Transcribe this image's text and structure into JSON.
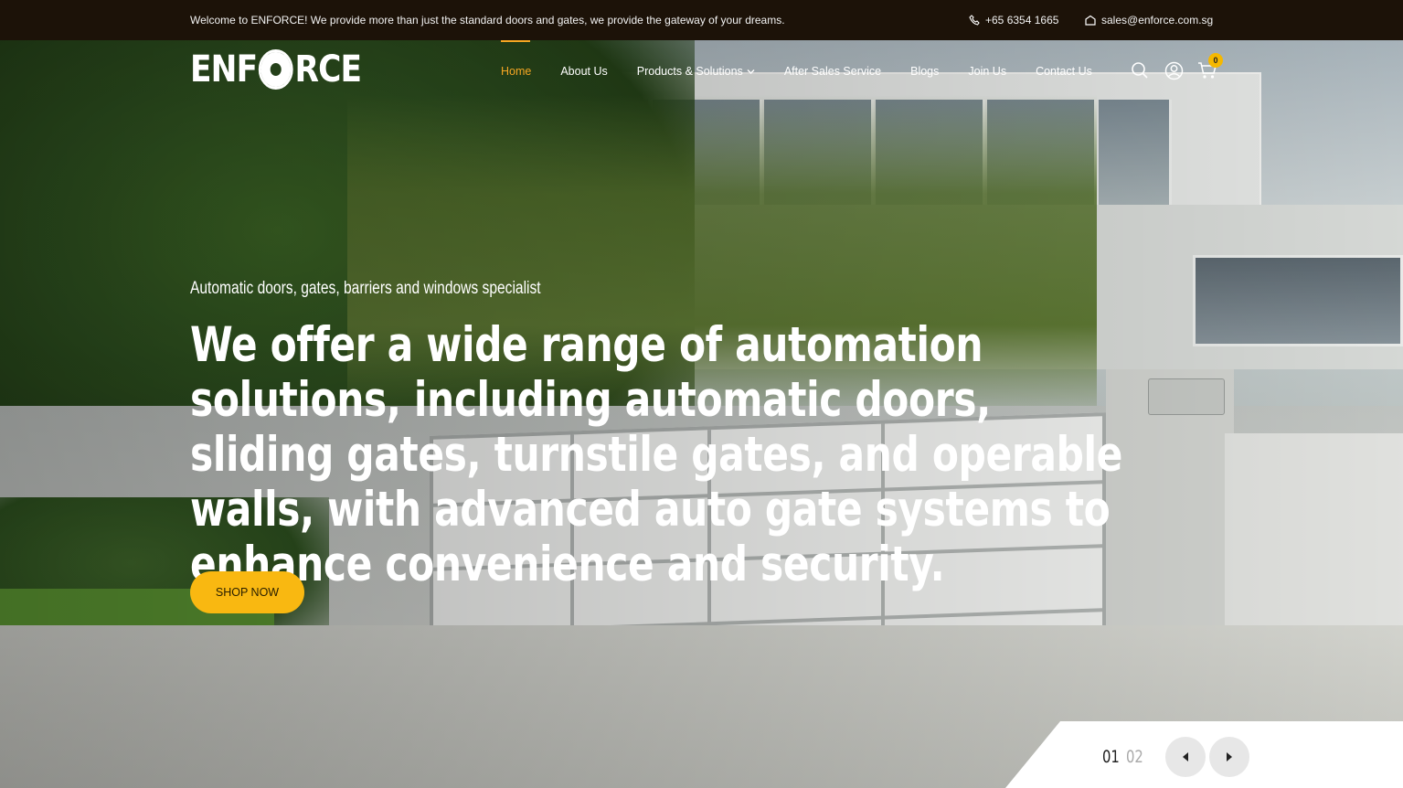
{
  "topbar": {
    "welcome": "Welcome to ENFORCE! We provide more than just the standard doors and gates, we provide the gateway of your dreams.",
    "phone": "+65 6354 1665",
    "email": "sales@enforce.com.sg"
  },
  "logo": {
    "left": "ENF",
    "right": "RCE"
  },
  "nav": {
    "items": [
      {
        "label": "Home",
        "active": true
      },
      {
        "label": "About Us"
      },
      {
        "label": "Products & Solutions",
        "has_dropdown": true
      },
      {
        "label": "After Sales Service"
      },
      {
        "label": "Blogs"
      },
      {
        "label": "Join Us"
      },
      {
        "label": "Contact Us"
      }
    ],
    "cart_count": "0",
    "icons": [
      "search-icon",
      "user-icon",
      "cart-icon"
    ]
  },
  "hero": {
    "subtitle": "Automatic doors, gates, barriers and windows specialist",
    "headline": "We offer a wide range of automation solutions, including automatic doors, sliding gates, turnstile gates, and operable walls, with advanced auto gate systems to enhance convenience and security.",
    "cta": "SHOP NOW"
  },
  "slider": {
    "current": "01",
    "next": "02"
  },
  "colors": {
    "topbar_bg": "#1c1208",
    "accent": "#f5a623",
    "button": "#f9b811"
  }
}
